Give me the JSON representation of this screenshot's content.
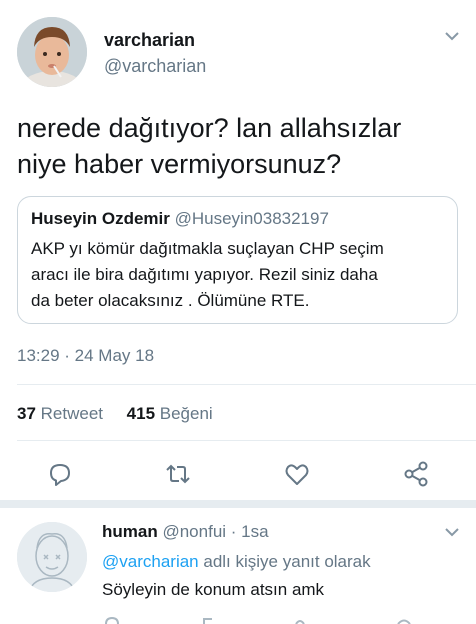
{
  "tweet": {
    "author": {
      "display_name": "varcharian",
      "handle": "@varcharian"
    },
    "text_line1": "nerede dağıtıyor? lan allahsızlar",
    "text_line2": "niye haber vermiyorsunuz?",
    "quoted": {
      "display_name": "Huseyin Ozdemir",
      "handle": "@Huseyin03832197",
      "text_line1": "AKP yı kömür dağıtmakla suçlayan CHP seçim",
      "text_line2": "aracı ile bira dağıtımı yapıyor. Rezil siniz daha",
      "text_line3": "da beter olacaksınız . Ölümüne RTE."
    },
    "timestamp": "13:29 · 24 May 18",
    "stats": {
      "retweet_count": "37",
      "retweet_label": "Retweet",
      "like_count": "415",
      "like_label": "Beğeni"
    },
    "actions": [
      {
        "icon": "reply-icon"
      },
      {
        "icon": "retweet-icon"
      },
      {
        "icon": "like-heart-icon"
      },
      {
        "icon": "share-icon"
      }
    ]
  },
  "reply": {
    "display_name": "human",
    "handle": "@nonfui",
    "time": "· 1sa",
    "mention": "@varcharian",
    "context_suffix": "adlı kişiye yanıt olarak",
    "text": "Söyleyin de konum atsın amk"
  },
  "colors": {
    "accent": "#1da1f2",
    "secondary_text": "#657786",
    "border": "#e6ecf0"
  }
}
